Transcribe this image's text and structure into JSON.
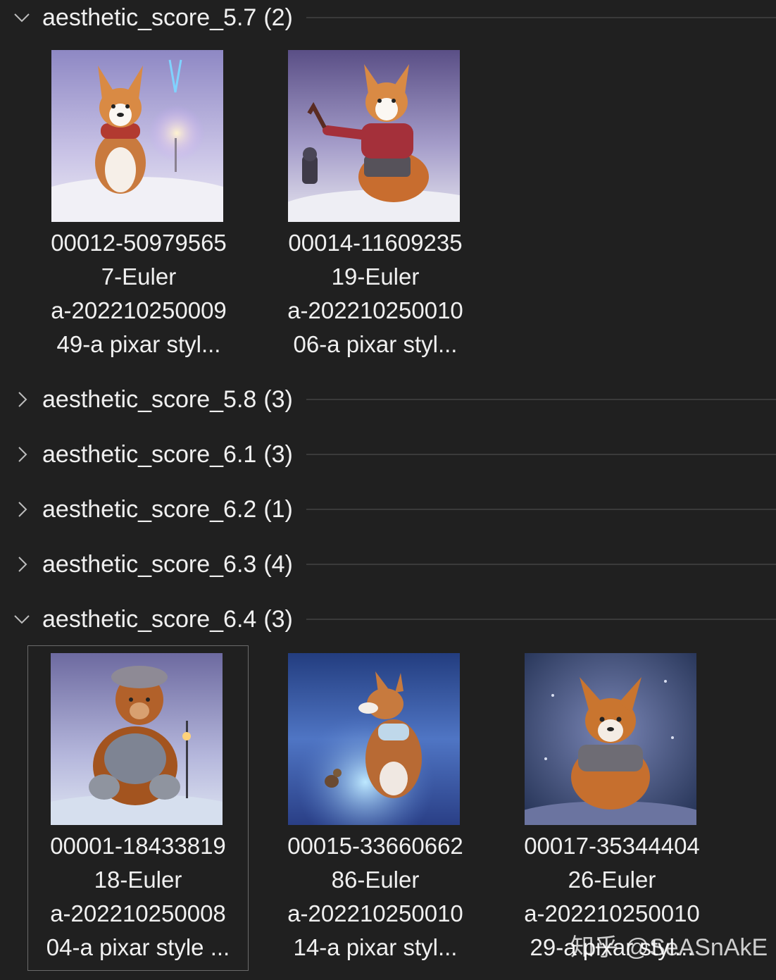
{
  "groups": [
    {
      "label": "aesthetic_score_5.7",
      "count": "(2)",
      "expanded": true,
      "items": [
        {
          "lines": [
            "00012-50979565",
            "7-Euler",
            "a-202210250009",
            "49-a pixar styl..."
          ]
        },
        {
          "lines": [
            "00014-11609235",
            "19-Euler",
            "a-202210250010",
            "06-a pixar styl..."
          ]
        }
      ]
    },
    {
      "label": "aesthetic_score_5.8",
      "count": "(3)",
      "expanded": false
    },
    {
      "label": "aesthetic_score_6.1",
      "count": "(3)",
      "expanded": false
    },
    {
      "label": "aesthetic_score_6.2",
      "count": "(1)",
      "expanded": false
    },
    {
      "label": "aesthetic_score_6.3",
      "count": "(4)",
      "expanded": false
    },
    {
      "label": "aesthetic_score_6.4",
      "count": "(3)",
      "expanded": true,
      "items": [
        {
          "lines": [
            "00001-18433819",
            "18-Euler",
            "a-202210250008",
            "04-a pixar style ..."
          ],
          "selected": true
        },
        {
          "lines": [
            "00015-33660662",
            "86-Euler",
            "a-202210250010",
            "14-a pixar styl..."
          ]
        },
        {
          "lines": [
            "00017-35344404",
            "26-Euler",
            "a-202210250010",
            "29-a pixar styl..."
          ]
        }
      ]
    }
  ],
  "watermark": "知乎 @SeASnAkE",
  "colors": {
    "background": "#202020",
    "text": "#f0f0f0",
    "separator": "#3a3a3a",
    "selection_border": "#6a6a6a"
  }
}
